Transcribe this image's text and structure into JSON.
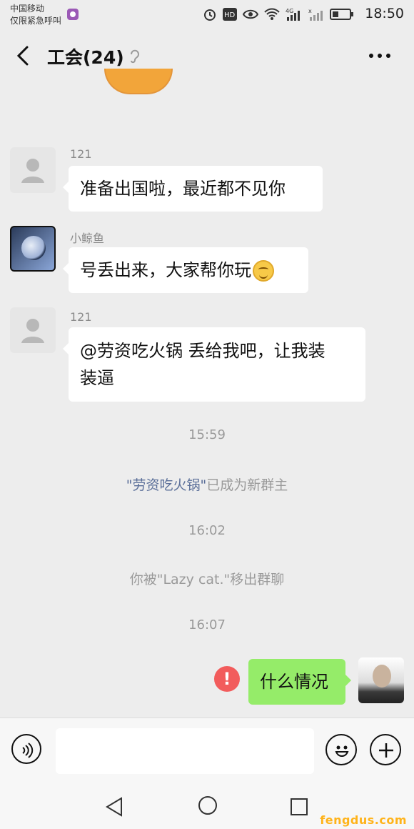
{
  "status_bar": {
    "carrier": "中国移动",
    "emergency": "仅限紧急呼叫",
    "network": "4G",
    "time": "18:50"
  },
  "header": {
    "title": "工会(24)"
  },
  "messages": [
    {
      "sender": "121",
      "text": "准备出国啦，最近都不见你"
    },
    {
      "sender": "小鲸鱼",
      "text": "号丢出来，大家帮你玩"
    },
    {
      "sender": "121",
      "text_line1": "@劳资吃火锅  丢给我吧，让我装",
      "text_line2": "装逼"
    }
  ],
  "events": {
    "time1": "15:59",
    "owner_name": "\"劳资吃火锅\"",
    "owner_suffix": "已成为新群主",
    "time2": "16:02",
    "removed_msg": "你被\"Lazy cat.\"移出群聊",
    "time3": "16:07"
  },
  "my_message": {
    "text": "什么情况",
    "error_mark": "!"
  },
  "input_bar": {
    "value": "",
    "placeholder": ""
  },
  "watermark": "fengdus.com"
}
